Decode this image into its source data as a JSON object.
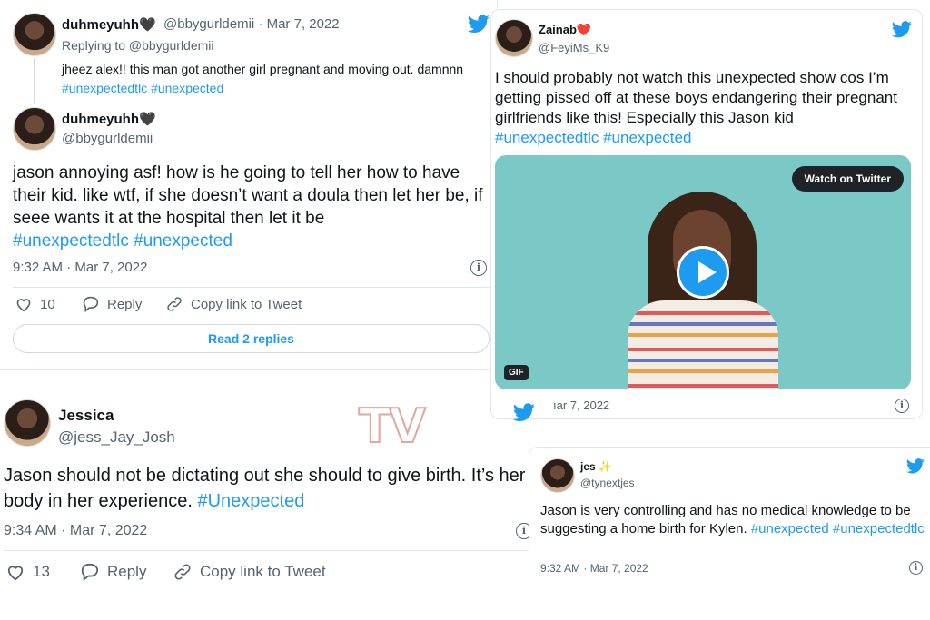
{
  "colors": {
    "accent": "#1d9bf0",
    "text": "#0f1419",
    "muted": "#536471"
  },
  "tweet1": {
    "reply": {
      "name": "duhmeyuhh🖤",
      "handle": "@bbygurldemii · Mar 7, 2022",
      "replying": "Replying to @bbygurldemii",
      "text": "jheez alex!! this man got another girl pregnant and moving out. damnnn",
      "hashtags": "#unexpectedtlc #unexpected"
    },
    "main": {
      "name": "duhmeyuhh🖤",
      "handle": "@bbygurldemii",
      "text": "jason annoying asf! how is he going to tell her how to have their kid. like wtf, if she doesn’t want a doula then let her be, if seee wants it at the hospital then let it be",
      "hashtags": "#unexpectedtlc #unexpected",
      "time": "9:32 AM · Mar 7, 2022",
      "likes": "10",
      "reply_label": "Reply",
      "copy_label": "Copy link to Tweet",
      "read_replies": "Read 2 replies"
    }
  },
  "tweet2": {
    "name": "Zainab❤️",
    "handle": "@FeyiMs_K9",
    "text": "I should probably not watch this unexpected show cos I’m getting pissed off at these boys endangering their pregnant girlfriends like this! Especially this Jason kid",
    "hashtags": "#unexpectedtlc #unexpected",
    "watch_label": "Watch on Twitter",
    "gif_label": "GIF",
    "time": "ıar 7, 2022"
  },
  "watermark": "TV",
  "tweet3": {
    "name": "Jessica",
    "handle": "@jess_Jay_Josh",
    "text": "Jason should not be dictating out she should to give birth. It’s her body in her experience.",
    "hashtags": "#Unexpected",
    "time": "9:34 AM · Mar 7, 2022",
    "likes": "13",
    "reply_label": "Reply",
    "copy_label": "Copy link to Tweet"
  },
  "tweet4": {
    "name": "jes ✨",
    "handle": "@tynextjes",
    "text": "Jason is very controlling and has no medical knowledge to be suggesting a home birth for Kylen.",
    "hashtag1": "#unexpected",
    "hashtag2": "#unexpectedtlc",
    "time": "9:32 AM · Mar 7, 2022"
  },
  "icons": [
    "twitter-bird-icon",
    "heart-icon",
    "reply-icon",
    "link-icon",
    "info-icon",
    "play-icon"
  ]
}
